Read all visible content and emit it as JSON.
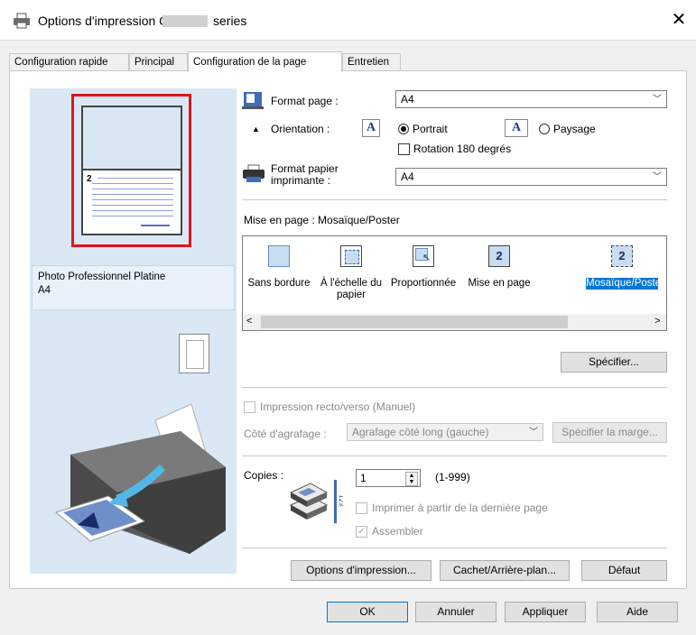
{
  "window": {
    "title": "Options d'impression Canon",
    "title_suffix": "series",
    "close_glyph": "✕"
  },
  "tabs": [
    {
      "label": "Configuration rapide"
    },
    {
      "label": "Principal"
    },
    {
      "label": "Configuration de la page",
      "active": true
    },
    {
      "label": "Entretien"
    }
  ],
  "preview": {
    "page_number": "2",
    "media_name": "Photo Professionnel Platine",
    "media_size": "A4"
  },
  "page_size": {
    "label": "Format page :",
    "value": "A4"
  },
  "orientation": {
    "label": "Orientation :",
    "portrait_label": "Portrait",
    "landscape_label": "Paysage",
    "selected": "Portrait",
    "icon_glyph": "A"
  },
  "rotate_180": {
    "label": "Rotation 180 degrés",
    "checked": false
  },
  "printer_paper_size": {
    "label_line1": "Format papier",
    "label_line2": "imprimante :",
    "value": "A4"
  },
  "page_layout": {
    "label": "Mise en page : Mosaïque/Poster",
    "items": [
      {
        "label": "Sans bordure"
      },
      {
        "label": "À l'échelle du papier"
      },
      {
        "label": "Proportionnée"
      },
      {
        "label": "Mise en page"
      },
      {
        "label": "Mosaïque/Poster",
        "selected": true
      }
    ],
    "icon_number": "2",
    "scroll_left": "<",
    "scroll_right": ">"
  },
  "specify_button": "Spécifier...",
  "duplex": {
    "label": "Impression recto/verso (Manuel)",
    "enabled": false
  },
  "stapling": {
    "label": "Côté d'agrafage :",
    "value": "Agrafage côté long (gauche)",
    "margin_button": "Spécifier la marge..."
  },
  "copies": {
    "label": "Copies :",
    "value": "1",
    "range": "(1-999)",
    "reverse_label": "Imprimer à partir de la dernière page",
    "collate_label": "Assembler",
    "collate_check": "✓"
  },
  "bottom_buttons": {
    "print_options": "Options d'impression...",
    "stamp": "Cachet/Arrière-plan...",
    "defaults": "Défaut"
  },
  "dialog_buttons": {
    "ok": "OK",
    "cancel": "Annuler",
    "apply": "Appliquer",
    "help": "Aide"
  }
}
